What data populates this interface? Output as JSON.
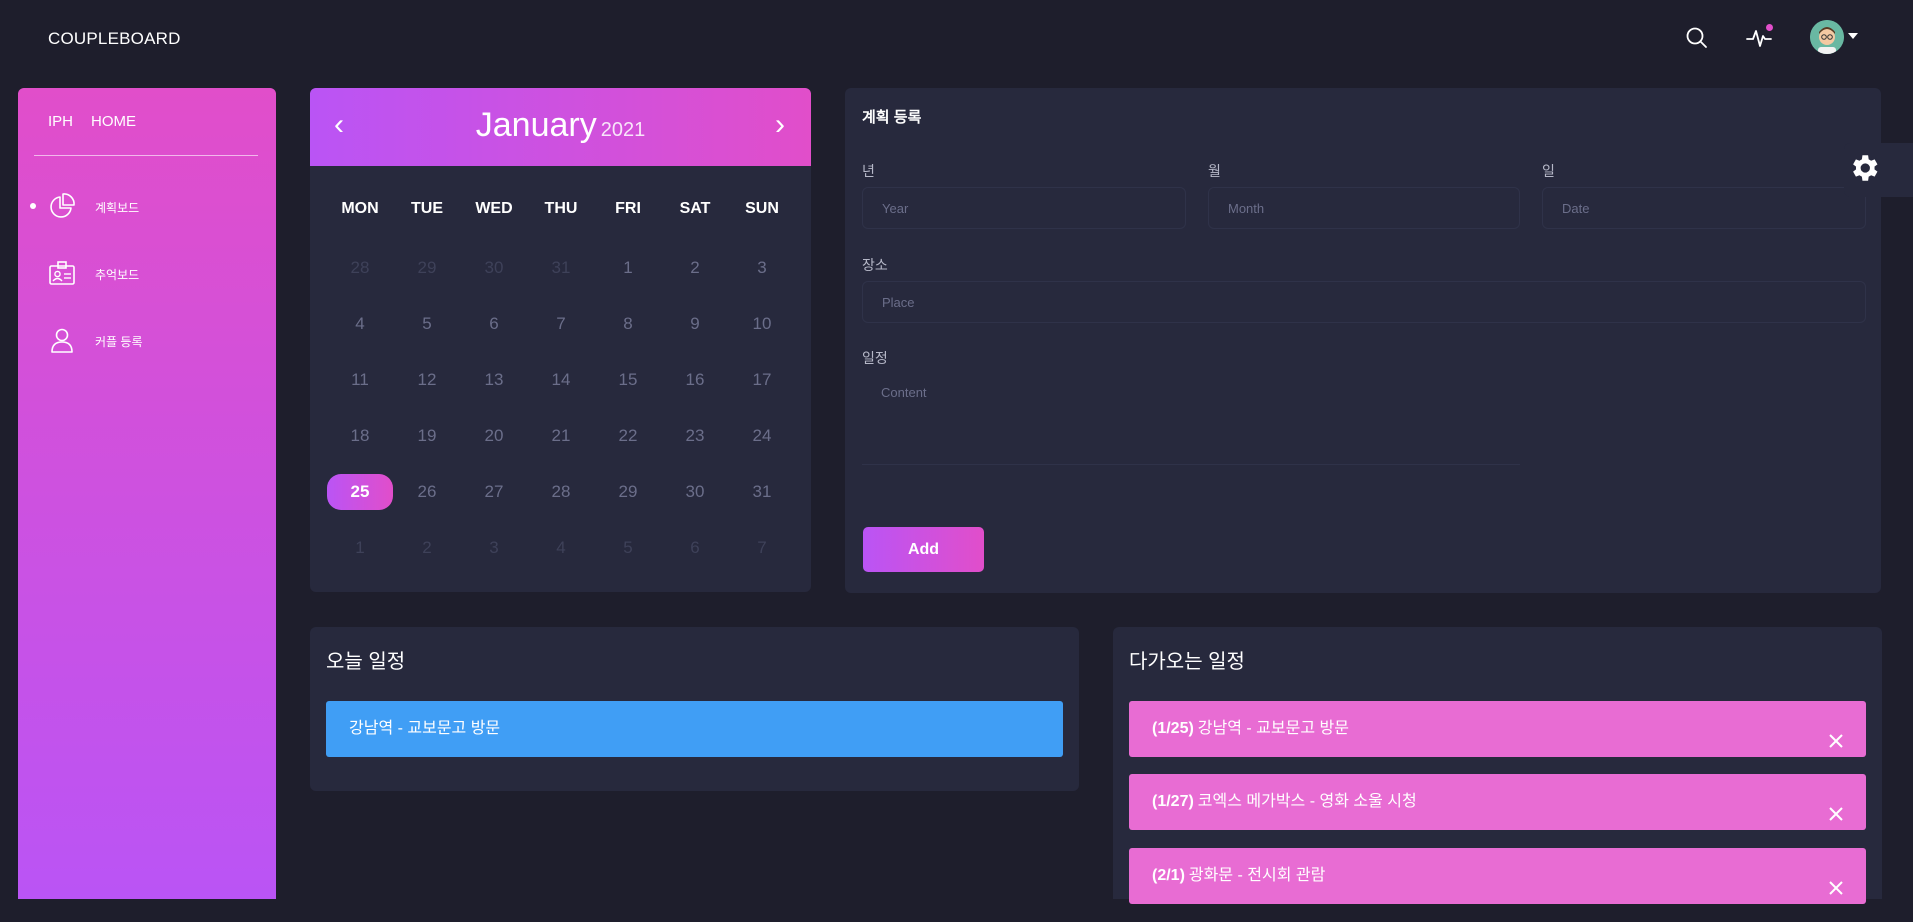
{
  "brand": "COUPLEBOARD",
  "topbar": {
    "icons": [
      "search-icon",
      "activity-icon",
      "avatar",
      "caret-down-icon"
    ]
  },
  "sidebar": {
    "head": [
      "IPH",
      "HOME"
    ],
    "items": [
      {
        "label": "계획보드",
        "icon": "pie-chart-icon",
        "active": true
      },
      {
        "label": "추억보드",
        "icon": "id-card-icon",
        "active": false
      },
      {
        "label": "커플 등록",
        "icon": "user-icon",
        "active": false
      }
    ]
  },
  "calendar": {
    "prev": "‹",
    "next": "›",
    "month": "January",
    "year": "2021",
    "weekdays": [
      "MON",
      "TUE",
      "WED",
      "THU",
      "FRI",
      "SAT",
      "SUN"
    ],
    "weeks": [
      [
        "28",
        "29",
        "30",
        "31",
        "1",
        "2",
        "3"
      ],
      [
        "4",
        "5",
        "6",
        "7",
        "8",
        "9",
        "10"
      ],
      [
        "11",
        "12",
        "13",
        "14",
        "15",
        "16",
        "17"
      ],
      [
        "18",
        "19",
        "20",
        "21",
        "22",
        "23",
        "24"
      ],
      [
        "25",
        "26",
        "27",
        "28",
        "29",
        "30",
        "31"
      ],
      [
        "1",
        "2",
        "3",
        "4",
        "5",
        "6",
        "7"
      ]
    ],
    "today": "25"
  },
  "plan_form": {
    "title": "계획 등록",
    "year_label": "년",
    "year_placeholder": "Year",
    "month_label": "월",
    "month_placeholder": "Month",
    "date_label": "일",
    "date_placeholder": "Date",
    "place_label": "장소",
    "place_placeholder": "Place",
    "schedule_label": "일정",
    "content_placeholder": "Content",
    "add_button": "Add"
  },
  "today_schedule": {
    "title": "오늘 일정",
    "items": [
      {
        "text": "강남역 - 교보문고 방문"
      }
    ]
  },
  "upcoming_schedule": {
    "title": "다가오는 일정",
    "items": [
      {
        "date": "(1/25)",
        "text": "강남역 - 교보문고 방문"
      },
      {
        "date": "(1/27)",
        "text": "코엑스 메가박스 - 영화 소울 시청"
      },
      {
        "date": "(2/1)",
        "text": "광화문 - 전시회 관람"
      }
    ]
  },
  "colors": {
    "background": "#1e1e2c",
    "card": "#27293d",
    "accent_pink": "#e14eca",
    "accent_purple": "#ba54f5",
    "today_bar": "#409ef5",
    "upcoming_bar": "#e86cd3"
  }
}
